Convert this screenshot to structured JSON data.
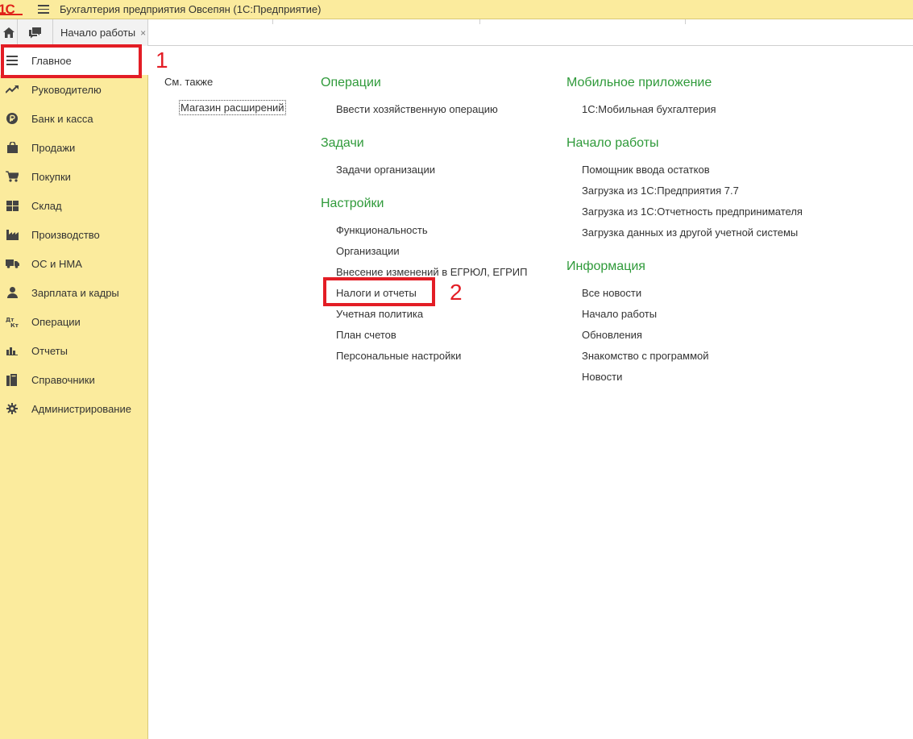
{
  "window": {
    "title": "Бухгалтерия предприятия Овсепян  (1С:Предприятие)",
    "logo_text": "1С"
  },
  "tabs": [
    {
      "label": "Начало работы",
      "close": "×"
    }
  ],
  "sidebar": {
    "items": [
      {
        "label": "Главное",
        "icon": "hamburger-icon",
        "active": true
      },
      {
        "label": "Руководителю",
        "icon": "trend-up-icon"
      },
      {
        "label": "Банк и касса",
        "icon": "ruble-icon"
      },
      {
        "label": "Продажи",
        "icon": "shopping-bag-icon"
      },
      {
        "label": "Покупки",
        "icon": "cart-icon"
      },
      {
        "label": "Склад",
        "icon": "warehouse-icon"
      },
      {
        "label": "Производство",
        "icon": "factory-icon"
      },
      {
        "label": "ОС и НМА",
        "icon": "truck-icon"
      },
      {
        "label": "Зарплата и кадры",
        "icon": "person-icon"
      },
      {
        "label": "Операции",
        "icon": "dt-kt-icon"
      },
      {
        "label": "Отчеты",
        "icon": "bar-chart-icon"
      },
      {
        "label": "Справочники",
        "icon": "books-icon"
      },
      {
        "label": "Администрирование",
        "icon": "gear-icon"
      }
    ]
  },
  "content": {
    "see_also": {
      "title": "См. также",
      "items": [
        "Магазин расширений"
      ]
    },
    "col1": [
      {
        "title": "Операции",
        "items": [
          "Ввести хозяйственную операцию"
        ]
      },
      {
        "title": "Задачи",
        "items": [
          "Задачи организации"
        ]
      },
      {
        "title": "Настройки",
        "items": [
          "Функциональность",
          "Организации",
          "Внесение изменений в ЕГРЮЛ, ЕГРИП",
          "Налоги и отчеты",
          "Учетная политика",
          "План счетов",
          "Персональные настройки"
        ]
      }
    ],
    "col2": [
      {
        "title": "Мобильное приложение",
        "items": [
          "1С:Мобильная бухгалтерия"
        ]
      },
      {
        "title": "Начало работы",
        "items": [
          "Помощник ввода остатков",
          "Загрузка из 1С:Предприятия 7.7",
          "Загрузка из 1С:Отчетность предпринимателя",
          "Загрузка данных из другой учетной системы"
        ]
      },
      {
        "title": "Информация",
        "items": [
          "Все новости",
          "Начало работы",
          "Обновления",
          "Знакомство с программой",
          "Новости"
        ]
      }
    ]
  },
  "annotations": [
    {
      "number": "1"
    },
    {
      "number": "2"
    }
  ],
  "colors": {
    "sidebar_bg": "#fbeb9d",
    "section_title": "#2f9a3a",
    "annotation": "#e31d25",
    "logo": "#e0231b"
  }
}
